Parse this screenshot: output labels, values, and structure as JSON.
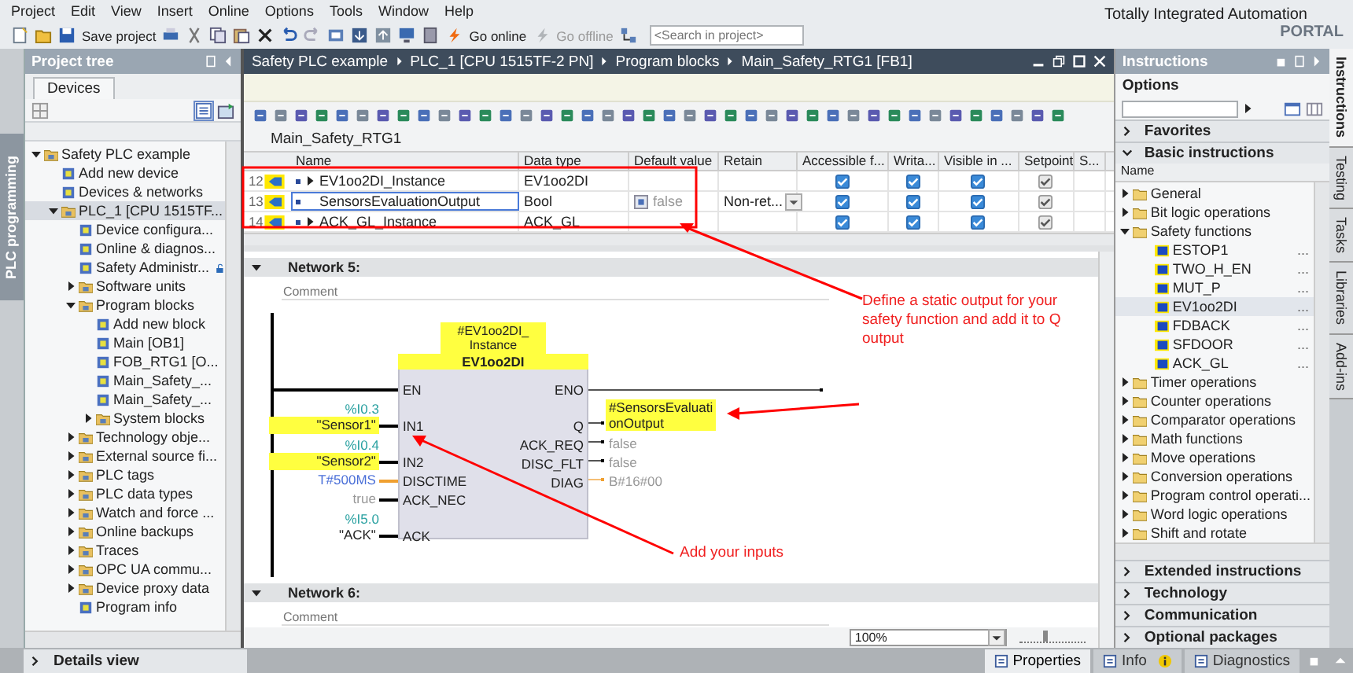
{
  "menu": [
    "Project",
    "Edit",
    "View",
    "Insert",
    "Online",
    "Options",
    "Tools",
    "Window",
    "Help"
  ],
  "toolbar": {
    "save_label": "Save project",
    "go_online": "Go online",
    "go_offline": "Go offline",
    "search": {
      "placeholder": "<Search in project>"
    }
  },
  "brand": {
    "line1": "Totally Integrated Automation",
    "line2": "PORTAL"
  },
  "left_side_tab": "PLC programming",
  "project_tree": {
    "title": "Project tree",
    "tab": "Devices",
    "details_view": "Details view",
    "items": [
      {
        "label": "Safety PLC example",
        "expanded": true,
        "selected": false,
        "children": [
          {
            "label": "Add new device",
            "selected": false
          },
          {
            "label": "Devices & networks",
            "selected": false
          },
          {
            "label": "PLC_1 [CPU 1515TF...",
            "expanded": true,
            "selected": true,
            "children": [
              {
                "label": "Device configura...",
                "selected": false
              },
              {
                "label": "Online & diagnos...",
                "selected": false
              },
              {
                "label": "Safety Administr...",
                "selected": false,
                "locked": true
              },
              {
                "label": "Software units",
                "expanded": false,
                "selected": false
              },
              {
                "label": "Program blocks",
                "expanded": true,
                "selected": false,
                "children": [
                  {
                    "label": "Add new block",
                    "selected": false
                  },
                  {
                    "label": "Main [OB1]",
                    "selected": false
                  },
                  {
                    "label": "FOB_RTG1 [O...",
                    "selected": false
                  },
                  {
                    "label": "Main_Safety_...",
                    "selected": false
                  },
                  {
                    "label": "Main_Safety_...",
                    "selected": false
                  },
                  {
                    "label": "System blocks",
                    "expanded": false,
                    "selected": false
                  }
                ]
              },
              {
                "label": "Technology obje...",
                "expanded": false,
                "selected": false
              },
              {
                "label": "External source fi...",
                "expanded": false,
                "selected": false
              },
              {
                "label": "PLC tags",
                "expanded": false,
                "selected": false
              },
              {
                "label": "PLC data types",
                "expanded": false,
                "selected": false
              },
              {
                "label": "Watch and force ...",
                "expanded": false,
                "selected": false
              },
              {
                "label": "Online backups",
                "expanded": false,
                "selected": false
              },
              {
                "label": "Traces",
                "expanded": false,
                "selected": false
              },
              {
                "label": "OPC UA commu...",
                "expanded": false,
                "selected": false
              },
              {
                "label": "Device proxy data",
                "expanded": false,
                "selected": false
              },
              {
                "label": "Program info",
                "selected": false
              }
            ]
          }
        ]
      }
    ]
  },
  "editor": {
    "breadcrumb": [
      "Safety PLC example",
      "PLC_1 [CPU 1515TF-2 PN]",
      "Program blocks",
      "Main_Safety_RTG1 [FB1]"
    ],
    "block_title": "Main_Safety_RTG1",
    "interface": {
      "columns": [
        "Name",
        "Data type",
        "Default value",
        "Retain",
        "Accessible f...",
        "Writa...",
        "Visible in ...",
        "Setpoint",
        "S..."
      ],
      "rows": [
        {
          "number": "12",
          "name": "EV1oo2DI_Instance",
          "expanded": false,
          "data_type": "EV1oo2DI",
          "selected": false,
          "checks": [
            {
              "checked": true,
              "disabled": false
            },
            {
              "checked": true,
              "disabled": false
            },
            {
              "checked": true,
              "disabled": false
            },
            {
              "checked": true,
              "disabled": true
            }
          ]
        },
        {
          "number": "13",
          "name": "SensorsEvaluationOutput",
          "data_type": "Bool",
          "default_value": "false",
          "retain": "Non-ret...",
          "selected": true,
          "checks": [
            {
              "checked": true,
              "disabled": false
            },
            {
              "checked": true,
              "disabled": false
            },
            {
              "checked": true,
              "disabled": false
            },
            {
              "checked": true,
              "disabled": true
            }
          ]
        },
        {
          "number": "14",
          "name": "ACK_GL_Instance",
          "expanded": false,
          "data_type": "ACK_GL",
          "selected": false,
          "checks": [
            {
              "checked": true,
              "disabled": false
            },
            {
              "checked": true,
              "disabled": false
            },
            {
              "checked": true,
              "disabled": false
            },
            {
              "checked": true,
              "disabled": true
            }
          ]
        }
      ]
    },
    "networks": [
      {
        "title": "Network 5:",
        "expanded": true,
        "comment_placeholder": "Comment",
        "instance_lines": [
          "#EV1oo2DI_",
          "Instance"
        ],
        "block": {
          "name": "EV1oo2DI",
          "inputs": [
            {
              "pin": "EN",
              "kind": "bool"
            },
            {
              "pin": "IN1",
              "kind": "bool",
              "address": "%I0.3",
              "operand": {
                "text": "\"Sensor1\"",
                "kind": "tag"
              },
              "highlighted": true
            },
            {
              "pin": "IN2",
              "kind": "bool",
              "address": "%I0.4",
              "operand": {
                "text": "\"Sensor2\"",
                "kind": "tag"
              },
              "highlighted": true
            },
            {
              "pin": "DISCTIME",
              "kind": "word",
              "operand": {
                "text": "T#500MS",
                "kind": "constant"
              },
              "highlighted": false
            },
            {
              "pin": "ACK_NEC",
              "kind": "bool",
              "operand": {
                "text": "true",
                "kind": "default"
              },
              "highlighted": false
            },
            {
              "pin": "ACK",
              "kind": "bool",
              "address": "%I5.0",
              "operand": {
                "text": "\"ACK\"",
                "kind": "tag"
              },
              "highlighted": false
            }
          ],
          "outputs": [
            {
              "pin": "ENO",
              "kind": "bool"
            },
            {
              "pin": "Q",
              "kind": "bool",
              "operand": {
                "lines": [
                  "#SensorsEvaluati",
                  "onOutput"
                ],
                "kind": "tag"
              },
              "highlighted": true
            },
            {
              "pin": "ACK_REQ",
              "kind": "bool",
              "operand": {
                "lines": [
                  "false"
                ],
                "kind": "default"
              },
              "highlighted": false
            },
            {
              "pin": "DISC_FLT",
              "kind": "bool",
              "operand": {
                "lines": [
                  "false"
                ],
                "kind": "default"
              },
              "highlighted": false
            },
            {
              "pin": "DIAG",
              "kind": "word",
              "operand": {
                "lines": [
                  "B#16#00"
                ],
                "kind": "default"
              },
              "highlighted": false
            }
          ]
        }
      },
      {
        "title": "Network 6:",
        "expanded": true,
        "comment_placeholder": "Comment"
      }
    ],
    "zoom": {
      "value": "100%",
      "level": 0.35
    }
  },
  "annotations": [
    {
      "kind": "output",
      "text": "Define a static output for your safety function and add it to Q output"
    },
    {
      "kind": "inputs",
      "text": "Add your inputs"
    }
  ],
  "instructions": {
    "title": "Instructions",
    "options_label": "Options",
    "sections": [
      {
        "label": "Favorites",
        "expanded": false
      },
      {
        "label": "Basic instructions",
        "expanded": true,
        "column": "Name",
        "items": [
          {
            "label": "General",
            "expanded": false,
            "selected": false
          },
          {
            "label": "Bit logic operations",
            "expanded": false,
            "selected": false
          },
          {
            "label": "Safety functions",
            "expanded": true,
            "selected": false,
            "children": [
              {
                "label": "ESTOP1",
                "column_2": "...",
                "selected": false
              },
              {
                "label": "TWO_H_EN",
                "column_2": "...",
                "selected": false
              },
              {
                "label": "MUT_P",
                "column_2": "...",
                "selected": false
              },
              {
                "label": "EV1oo2DI",
                "column_2": "...",
                "selected": true
              },
              {
                "label": "FDBACK",
                "column_2": "...",
                "selected": false
              },
              {
                "label": "SFDOOR",
                "column_2": "...",
                "selected": false
              },
              {
                "label": "ACK_GL",
                "column_2": "...",
                "selected": false
              }
            ]
          },
          {
            "label": "Timer operations",
            "expanded": false,
            "selected": false
          },
          {
            "label": "Counter operations",
            "expanded": false,
            "selected": false
          },
          {
            "label": "Comparator operations",
            "expanded": false,
            "selected": false
          },
          {
            "label": "Math functions",
            "expanded": false,
            "selected": false
          },
          {
            "label": "Move operations",
            "expanded": false,
            "selected": false
          },
          {
            "label": "Conversion operations",
            "expanded": false,
            "selected": false
          },
          {
            "label": "Program control operati...",
            "expanded": false,
            "selected": false
          },
          {
            "label": "Word logic operations",
            "expanded": false,
            "selected": false
          },
          {
            "label": "Shift and rotate",
            "expanded": false,
            "selected": false
          }
        ]
      },
      {
        "label": "Extended instructions",
        "expanded": false
      },
      {
        "label": "Technology",
        "expanded": false
      },
      {
        "label": "Communication",
        "expanded": false
      },
      {
        "label": "Optional packages",
        "expanded": false
      }
    ]
  },
  "right_side_tabs": [
    {
      "label": "Instructions",
      "selected": true
    },
    {
      "label": "Testing",
      "selected": false
    },
    {
      "label": "Tasks",
      "selected": false
    },
    {
      "label": "Libraries",
      "selected": false
    },
    {
      "label": "Add-ins",
      "selected": false
    }
  ],
  "bottom_tabs": [
    {
      "label": "Properties",
      "selected": true,
      "badge": false
    },
    {
      "label": "Info",
      "selected": false,
      "badge": true
    },
    {
      "label": "Diagnostics",
      "selected": false,
      "badge": false
    }
  ]
}
